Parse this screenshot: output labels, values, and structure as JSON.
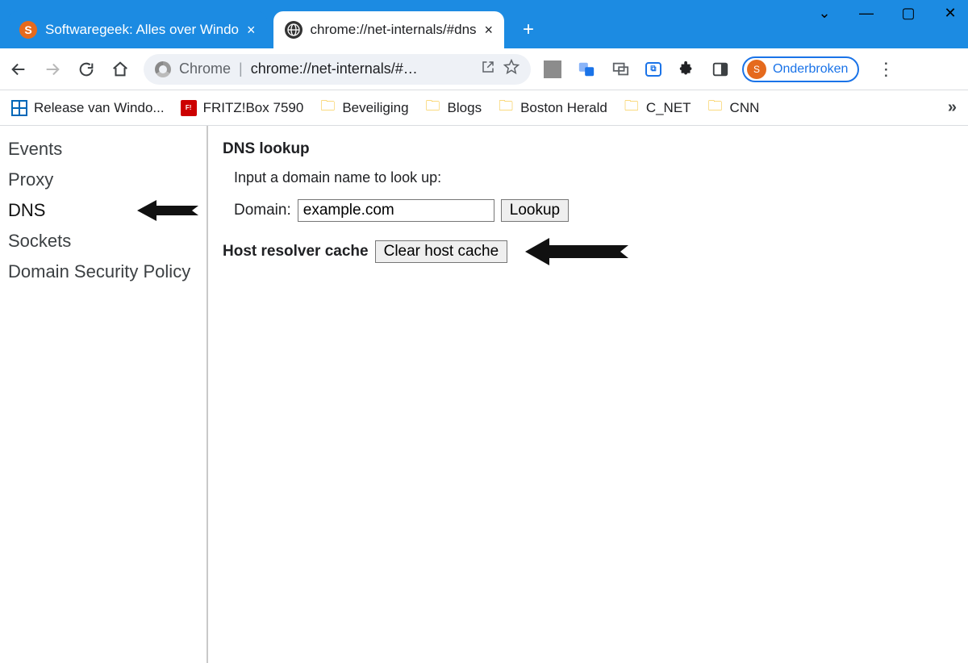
{
  "window_controls": {
    "minimize": "—",
    "maximize": "▢",
    "close": "✕",
    "chevron": "⌄"
  },
  "tabs": {
    "items": [
      {
        "label": "Softwaregeek: Alles over Windo",
        "active": false
      },
      {
        "label": "chrome://net-internals/#dns",
        "active": true
      }
    ],
    "newtab": "+"
  },
  "toolbar": {
    "scheme": "Chrome",
    "url": "chrome://net-internals/#…",
    "profile_label": "Onderbroken"
  },
  "bookmarks": {
    "items": [
      {
        "label": "Release van Windo...",
        "icon": "win"
      },
      {
        "label": "FRITZ!Box 7590",
        "icon": "fritz"
      },
      {
        "label": "Beveiliging",
        "icon": "folder"
      },
      {
        "label": "Blogs",
        "icon": "folder"
      },
      {
        "label": "Boston Herald",
        "icon": "folder"
      },
      {
        "label": "C_NET",
        "icon": "folder"
      },
      {
        "label": "CNN",
        "icon": "folder"
      }
    ],
    "overflow": "»"
  },
  "sidebar": {
    "items": [
      {
        "label": "Events"
      },
      {
        "label": "Proxy"
      },
      {
        "label": "DNS"
      },
      {
        "label": "Sockets"
      },
      {
        "label": "Domain Security Policy"
      }
    ]
  },
  "main": {
    "dns_lookup_heading": "DNS lookup",
    "instruction": "Input a domain name to look up:",
    "domain_label": "Domain:",
    "domain_value": "example.com",
    "lookup_button": "Lookup",
    "resolver_heading": "Host resolver cache",
    "clear_button": "Clear host cache"
  }
}
